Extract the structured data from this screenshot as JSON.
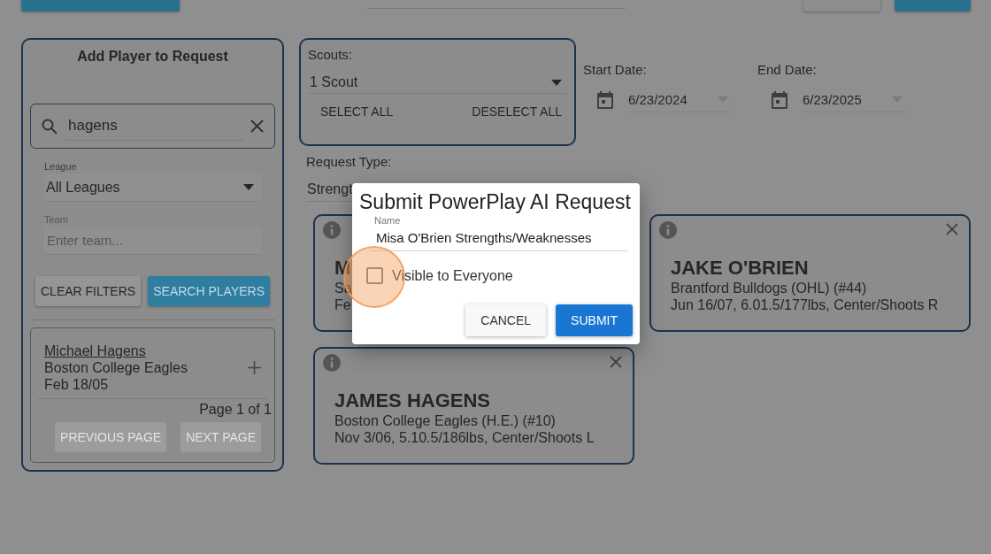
{
  "add_player_panel": {
    "title": "Add Player to Request",
    "search": {
      "value": "hagens"
    },
    "league": {
      "label": "League",
      "value": "All Leagues"
    },
    "team": {
      "label": "Team",
      "placeholder": "Enter team..."
    },
    "buttons": [
      {
        "label": "CLEAR FILTERS",
        "kind": "plain"
      },
      {
        "label": "SEARCH PLAYERS",
        "kind": "primary"
      }
    ],
    "results": [
      {
        "name": "Michael Hagens",
        "team": "Boston College Eagles",
        "born": "Feb 18/05"
      }
    ],
    "pagination": {
      "text": "Page 1 of 1",
      "buttons": [
        {
          "label": "PREVIOUS PAGE",
          "disabled": true
        },
        {
          "label": "NEXT PAGE",
          "disabled": true
        }
      ]
    }
  },
  "scouts": {
    "label": "Scouts:",
    "value": "1 Scout",
    "buttons": [
      "SELECT ALL",
      "DESELECT ALL"
    ]
  },
  "dates": [
    {
      "label": "Start Date:",
      "value": "6/23/2024"
    },
    {
      "label": "End Date:",
      "value": "6/23/2025"
    }
  ],
  "request_type": {
    "label": "Request Type:",
    "value": "Strengt"
  },
  "players": [
    {
      "name": "M",
      "team": "Sa",
      "details": "Fe",
      "kind": "covered"
    },
    {
      "name": "JAKE O'BRIEN",
      "team": "Brantford Bulldogs (OHL) (#44)",
      "details": "Jun 16/07, 6.01.5/177lbs, Center/Shoots R",
      "kind": "full"
    },
    {
      "name": "JAMES HAGENS",
      "team": "Boston College Eagles (H.E.) (#10)",
      "details": "Nov 3/06, 5.10.5/186lbs, Center/Shoots L",
      "kind": "full"
    }
  ],
  "dialog": {
    "title": "Submit PowerPlay AI Request",
    "name_label": "Name",
    "name_value": "Misa O'Brien Strengths/Weaknesses",
    "visible_label": "Visible to Everyone",
    "visible_checked": false,
    "buttons": [
      {
        "label": "CANCEL",
        "kind": "plain"
      },
      {
        "label": "SUBMIT",
        "kind": "primary"
      }
    ]
  }
}
